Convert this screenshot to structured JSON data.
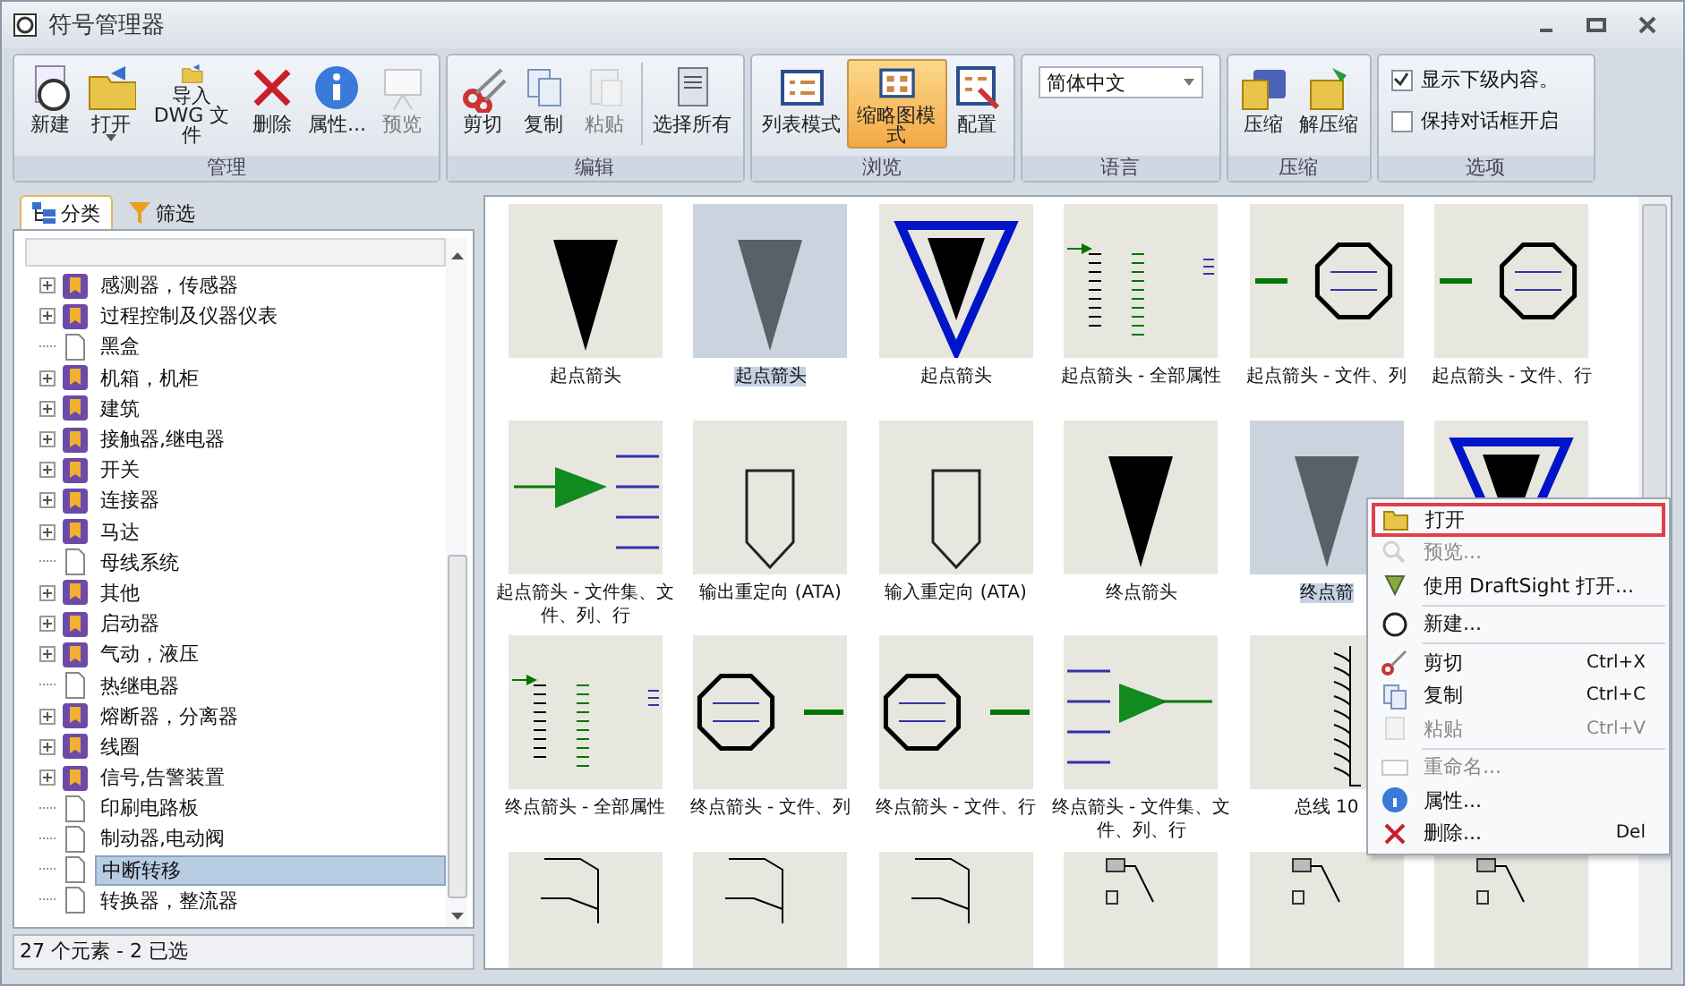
{
  "window": {
    "title": "符号管理器"
  },
  "ribbon": {
    "groups": [
      {
        "label": "管理",
        "buttons": [
          {
            "label": "新建",
            "disabled": false
          },
          {
            "label": "打开",
            "disabled": false,
            "dropdown": true
          },
          {
            "label": "导入 DWG 文件",
            "disabled": false
          },
          {
            "label": "删除",
            "disabled": false
          },
          {
            "label": "属性...",
            "disabled": false
          },
          {
            "label": "预览",
            "disabled": true
          }
        ]
      },
      {
        "label": "编辑",
        "buttons": [
          {
            "label": "剪切",
            "disabled": false
          },
          {
            "label": "复制",
            "disabled": false
          },
          {
            "label": "粘贴",
            "disabled": true
          },
          {
            "label": "选择所有",
            "disabled": false
          }
        ]
      },
      {
        "label": "浏览",
        "buttons": [
          {
            "label": "列表模式",
            "selected": false
          },
          {
            "label": "缩略图模式",
            "selected": true
          },
          {
            "label": "配置",
            "selected": false
          }
        ]
      },
      {
        "label": "语言",
        "dropdown": {
          "value": "简体中文"
        }
      },
      {
        "label": "压缩",
        "buttons": [
          {
            "label": "压缩",
            "disabled": false
          },
          {
            "label": "解压缩",
            "disabled": false
          }
        ]
      },
      {
        "label": "选项",
        "checkboxes": [
          {
            "label": "显示下级内容。",
            "checked": true
          },
          {
            "label": "保持对话框开启",
            "checked": false
          }
        ]
      }
    ]
  },
  "tabs": [
    {
      "label": "分类",
      "selected": true
    },
    {
      "label": "筛选",
      "selected": false
    }
  ],
  "tree": [
    {
      "label": "感测器，传感器",
      "folder": true,
      "selected": false
    },
    {
      "label": "过程控制及仪器仪表",
      "folder": true,
      "selected": false
    },
    {
      "label": "黑盒",
      "folder": false,
      "selected": false
    },
    {
      "label": "机箱，机柜",
      "folder": true,
      "selected": false
    },
    {
      "label": "建筑",
      "folder": true,
      "selected": false
    },
    {
      "label": "接触器,继电器",
      "folder": true,
      "selected": false
    },
    {
      "label": "开关",
      "folder": true,
      "selected": false
    },
    {
      "label": "连接器",
      "folder": true,
      "selected": false
    },
    {
      "label": "马达",
      "folder": true,
      "selected": false
    },
    {
      "label": "母线系统",
      "folder": false,
      "selected": false
    },
    {
      "label": "其他",
      "folder": true,
      "selected": false
    },
    {
      "label": "启动器",
      "folder": true,
      "selected": false
    },
    {
      "label": "气动，液压",
      "folder": true,
      "selected": false
    },
    {
      "label": "热继电器",
      "folder": false,
      "selected": false
    },
    {
      "label": "熔断器，分离器",
      "folder": true,
      "selected": false
    },
    {
      "label": "线圈",
      "folder": true,
      "selected": false
    },
    {
      "label": "信号,告警装置",
      "folder": true,
      "selected": false
    },
    {
      "label": "印刷电路板",
      "folder": false,
      "selected": false
    },
    {
      "label": "制动器,电动阀",
      "folder": false,
      "selected": false
    },
    {
      "label": "中断转移",
      "folder": false,
      "selected": true
    },
    {
      "label": "转换器，整流器",
      "folder": false,
      "selected": false
    }
  ],
  "status_bar": "27 个元素 - 2 已选",
  "symbol_rows": [
    [
      {
        "label": "起点箭头",
        "kind": "triangle",
        "selected": false
      },
      {
        "label": "起点箭头",
        "kind": "triangle",
        "selected": true
      },
      {
        "label": "起点箭头",
        "kind": "ring",
        "selected": false
      },
      {
        "label": "起点箭头 - 全部属性",
        "kind": "attrs",
        "selected": false
      },
      {
        "label": "起点箭头 - 文件、列",
        "kind": "octleft",
        "selected": false
      },
      {
        "label": "起点箭头 - 文件、行",
        "kind": "octleft",
        "selected": false
      }
    ],
    [
      {
        "label": "起点箭头 - 文件集、文件、列、行",
        "kind": "arrowlines",
        "selected": false
      },
      {
        "label": "输出重定向 (ATA)",
        "kind": "pentagon",
        "selected": false
      },
      {
        "label": "输入重定向 (ATA)",
        "kind": "pentagon",
        "selected": false
      },
      {
        "label": "终点箭头",
        "kind": "triangle",
        "selected": false
      },
      {
        "label": "终点箭",
        "kind": "triangle",
        "selected": true
      },
      {
        "kind": "ring",
        "selected": false
      }
    ],
    [
      {
        "label": "终点箭头 - 全部属性",
        "kind": "attrs",
        "selected": false
      },
      {
        "label": "终点箭头 - 文件、列",
        "kind": "octright",
        "selected": false
      },
      {
        "label": "终点箭头 - 文件、行",
        "kind": "octright",
        "selected": false
      },
      {
        "label": "终点箭头 - 文件集、文件、列、行",
        "kind": "linesarrow",
        "selected": false
      },
      {
        "label": "总线 10",
        "kind": "bus",
        "selected": false
      }
    ],
    [
      {
        "kind": "bracket",
        "selected": false
      },
      {
        "kind": "bracket",
        "selected": false
      },
      {
        "kind": "bracket",
        "selected": false
      },
      {
        "kind": "boxes",
        "selected": false
      },
      {
        "kind": "boxes",
        "selected": false
      },
      {
        "kind": "boxes",
        "selected": false
      }
    ]
  ],
  "context_menu": [
    {
      "kind": "item",
      "label": "打开",
      "disabled": false,
      "outlined": true
    },
    {
      "kind": "item",
      "label": "预览...",
      "disabled": true,
      "outlined": false
    },
    {
      "kind": "item",
      "label": "使用 DraftSight 打开...",
      "disabled": false,
      "outlined": false
    },
    {
      "kind": "separator"
    },
    {
      "kind": "item",
      "label": "新建...",
      "disabled": false,
      "outlined": false
    },
    {
      "kind": "separator"
    },
    {
      "kind": "item",
      "label": "剪切",
      "shortcut": "Ctrl+X",
      "disabled": false,
      "outlined": false
    },
    {
      "kind": "item",
      "label": "复制",
      "shortcut": "Ctrl+C",
      "disabled": false,
      "outlined": false
    },
    {
      "kind": "item",
      "label": "粘贴",
      "shortcut": "Ctrl+V",
      "disabled": true,
      "outlined": false
    },
    {
      "kind": "separator"
    },
    {
      "kind": "item",
      "label": "重命名...",
      "disabled": true,
      "outlined": false
    },
    {
      "kind": "item",
      "label": "属性...",
      "disabled": false,
      "outlined": false
    },
    {
      "kind": "item",
      "label": "删除...",
      "shortcut": "Del",
      "disabled": false,
      "outlined": false
    }
  ]
}
